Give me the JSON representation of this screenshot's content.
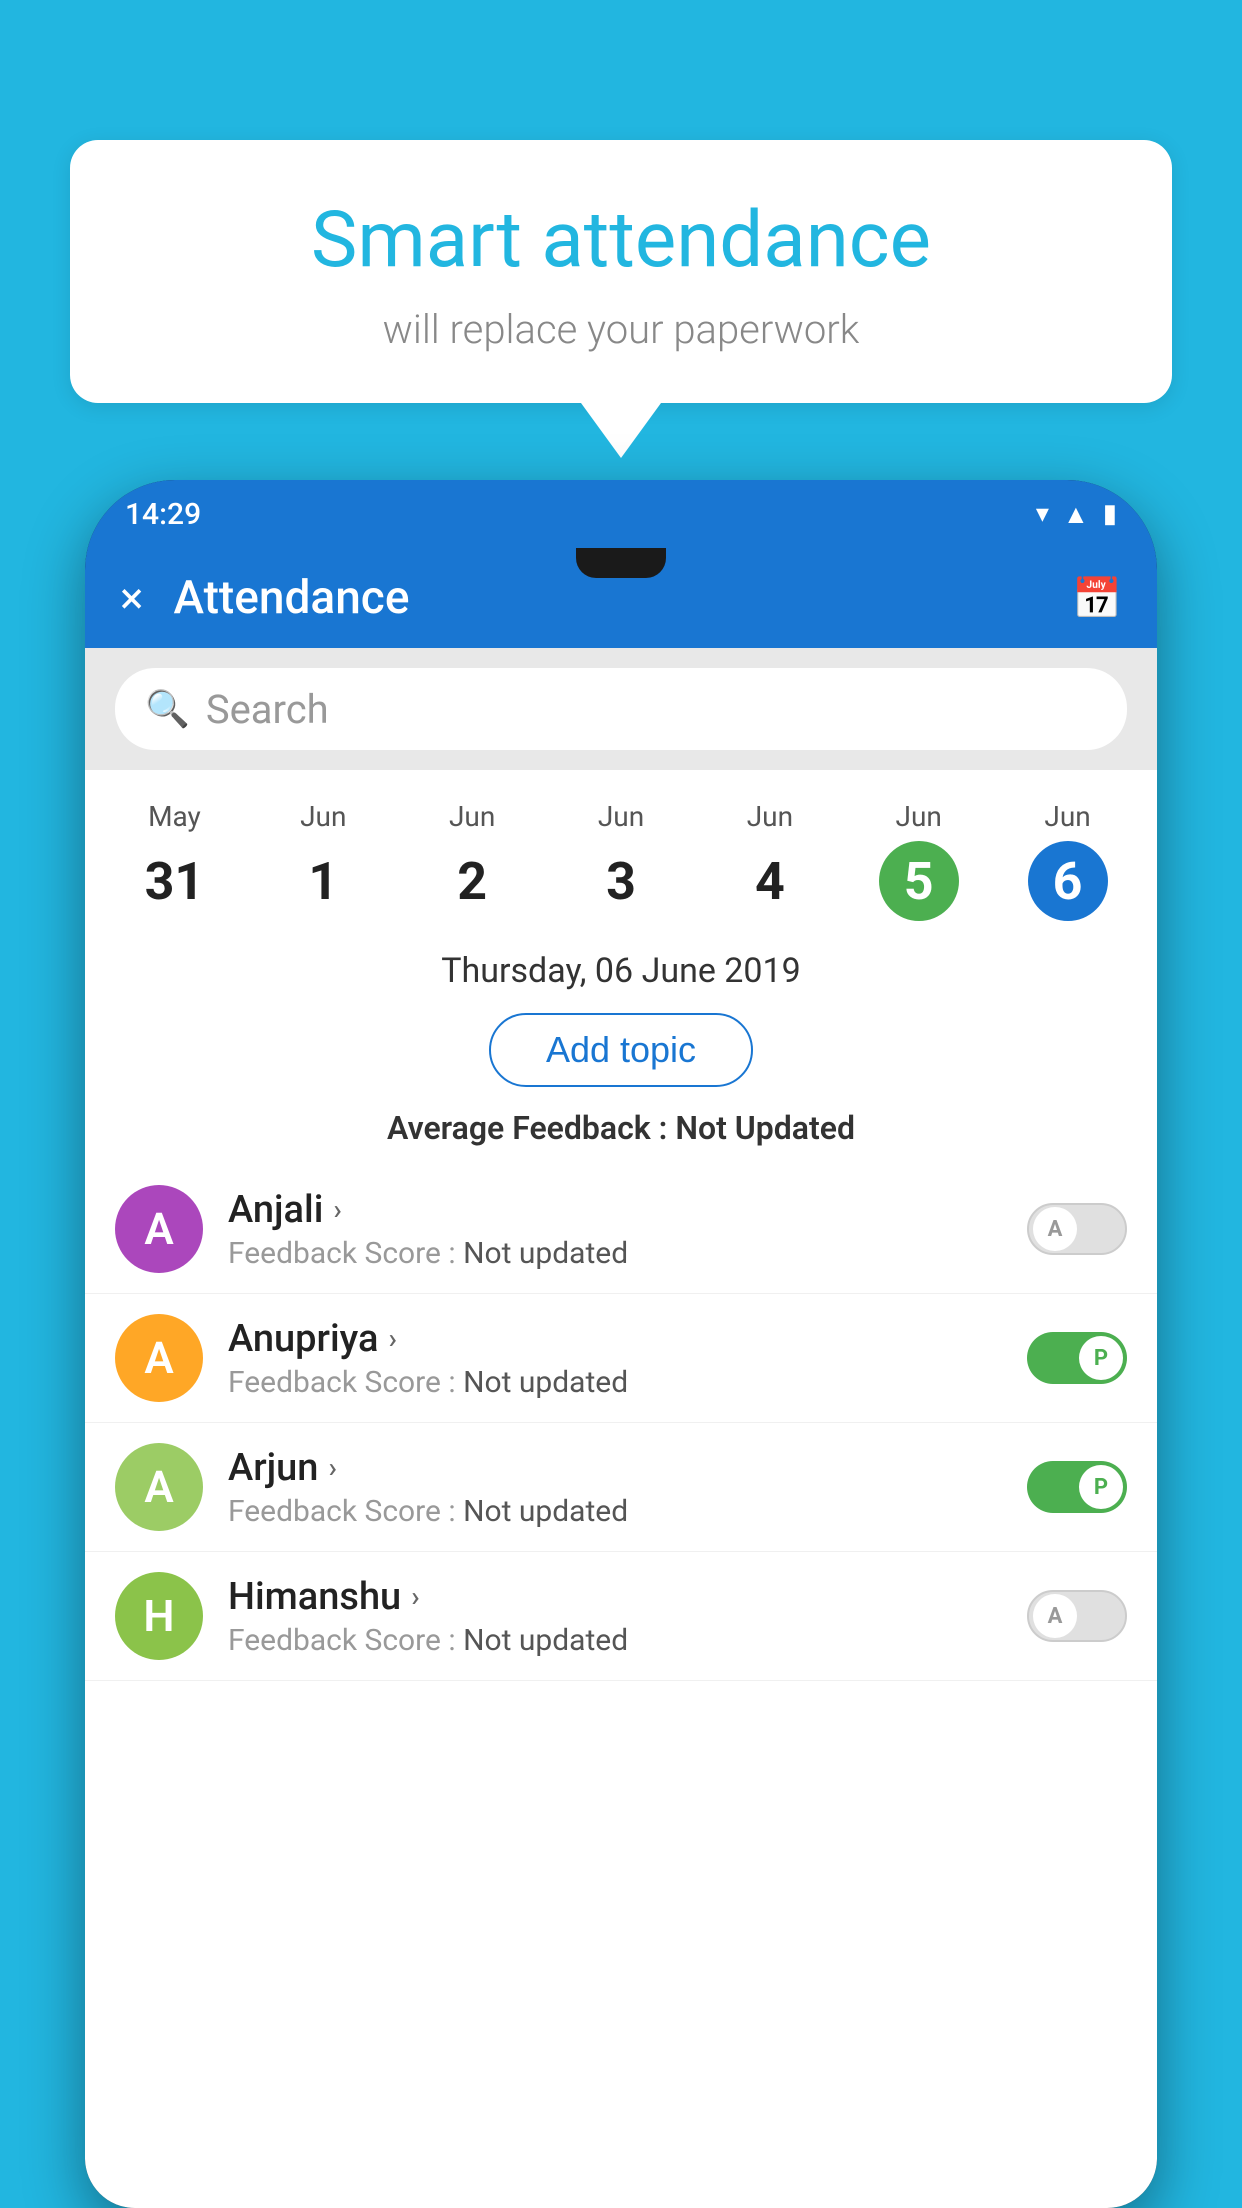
{
  "background_color": "#22b6e0",
  "speech_bubble": {
    "title": "Smart attendance",
    "subtitle": "will replace your paperwork"
  },
  "status_bar": {
    "time": "14:29",
    "icons": [
      "wifi",
      "signal",
      "battery"
    ]
  },
  "app_bar": {
    "title": "Attendance",
    "close_label": "×",
    "calendar_label": "📅"
  },
  "search": {
    "placeholder": "Search"
  },
  "calendar": {
    "days": [
      {
        "month": "May",
        "date": "31",
        "state": "normal"
      },
      {
        "month": "Jun",
        "date": "1",
        "state": "normal"
      },
      {
        "month": "Jun",
        "date": "2",
        "state": "normal"
      },
      {
        "month": "Jun",
        "date": "3",
        "state": "normal"
      },
      {
        "month": "Jun",
        "date": "4",
        "state": "normal"
      },
      {
        "month": "Jun",
        "date": "5",
        "state": "today"
      },
      {
        "month": "Jun",
        "date": "6",
        "state": "selected"
      }
    ]
  },
  "selected_date_label": "Thursday, 06 June 2019",
  "add_topic_label": "Add topic",
  "average_feedback": {
    "label": "Average Feedback : ",
    "value": "Not Updated"
  },
  "students": [
    {
      "name": "Anjali",
      "avatar_letter": "A",
      "avatar_color": "#ab47bc",
      "feedback_label": "Feedback Score : ",
      "feedback_value": "Not updated",
      "toggle_state": "off",
      "toggle_letter": "A"
    },
    {
      "name": "Anupriya",
      "avatar_letter": "A",
      "avatar_color": "#ffa726",
      "feedback_label": "Feedback Score : ",
      "feedback_value": "Not updated",
      "toggle_state": "on",
      "toggle_letter": "P"
    },
    {
      "name": "Arjun",
      "avatar_letter": "A",
      "avatar_color": "#9ccc65",
      "feedback_label": "Feedback Score : ",
      "feedback_value": "Not updated",
      "toggle_state": "on",
      "toggle_letter": "P"
    },
    {
      "name": "Himanshu",
      "avatar_letter": "H",
      "avatar_color": "#8bc34a",
      "feedback_label": "Feedback Score : ",
      "feedback_value": "Not updated",
      "toggle_state": "off",
      "toggle_letter": "A"
    }
  ]
}
